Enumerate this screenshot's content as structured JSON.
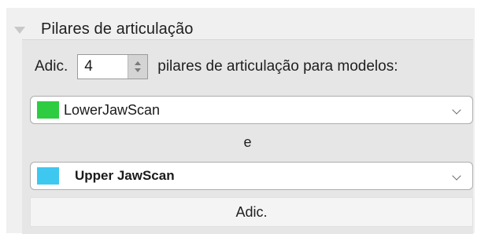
{
  "section": {
    "title": "Pilares de articulação",
    "expanded": true
  },
  "add_row": {
    "prefix_label": "Adic.",
    "count_value": "4",
    "suffix_label": "pilares de articulação para modelos:"
  },
  "model_select_1": {
    "selected": "LowerJawScan",
    "swatch_color": "#2ecc40"
  },
  "conjunction": "e",
  "model_select_2": {
    "selected": "Upper JawScan",
    "swatch_color": "#3ec8f0"
  },
  "add_button_label": "Adic."
}
